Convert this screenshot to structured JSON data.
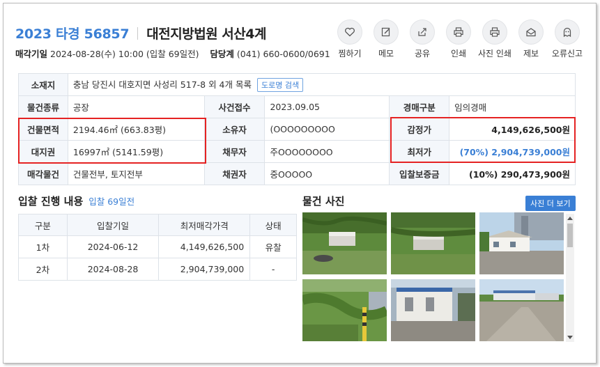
{
  "header": {
    "case_number": "2023 타경 56857",
    "court": "대전지방법원 서산4계",
    "auction_date_label": "매각기일",
    "auction_date_value": "2024-08-28(수) 10:00 (입찰 69일전)",
    "manager_label": "담당계",
    "manager_value": "(041) 660-0600/0691"
  },
  "actions": [
    {
      "label": "찜하기",
      "icon": "heart-icon"
    },
    {
      "label": "메모",
      "icon": "edit-icon"
    },
    {
      "label": "공유",
      "icon": "share-icon"
    },
    {
      "label": "인쇄",
      "icon": "print-icon"
    },
    {
      "label": "사진 인쇄",
      "icon": "print-icon"
    },
    {
      "label": "제보",
      "icon": "mail-icon"
    },
    {
      "label": "오류신고",
      "icon": "ghost-icon"
    }
  ],
  "info": {
    "location_label": "소재지",
    "location_value": "충남 당진시 대호지면 사성리 517-8 외 4개 목록",
    "road_search": "도로명 검색",
    "type_label": "물건종류",
    "type_value": "공장",
    "received_label": "사건접수",
    "received_value": "2023.09.05",
    "auction_type_label": "경매구분",
    "auction_type_value": "임의경매",
    "building_area_label": "건물면적",
    "building_area_value": "2194.46㎡ (663.83평)",
    "owner_label": "소유자",
    "owner_value": "(OOOOOOOOO",
    "appraisal_label": "감정가",
    "appraisal_value": "4,149,626,500원",
    "land_label": "대지권",
    "land_value": "16997㎡ (5141.59평)",
    "debtor_label": "채무자",
    "debtor_value": "주OOOOOOOO",
    "min_price_label": "최저가",
    "min_price_value": "(70%) 2,904,739,000원",
    "sale_items_label": "매각물건",
    "sale_items_value": "건물전부, 토지전부",
    "creditor_label": "채권자",
    "creditor_value": "중OOOOO",
    "deposit_label": "입찰보증금",
    "deposit_value": "(10%) 290,473,900원"
  },
  "bidding": {
    "title": "입찰 진행 내용",
    "note": "입찰 69일전",
    "headers": [
      "구분",
      "입찰기일",
      "최저매각가격",
      "상태"
    ],
    "rows": [
      [
        "1차",
        "2024-06-12",
        "4,149,626,500",
        "유찰"
      ],
      [
        "2차",
        "2024-08-28",
        "2,904,739,000",
        "-"
      ]
    ]
  },
  "photos": {
    "title": "물건 사진",
    "more_button": "사진 더 보기"
  },
  "colors": {
    "accent": "#3a7fd5",
    "highlight_box": "#e52222",
    "header_cell": "#f4f7fb"
  }
}
